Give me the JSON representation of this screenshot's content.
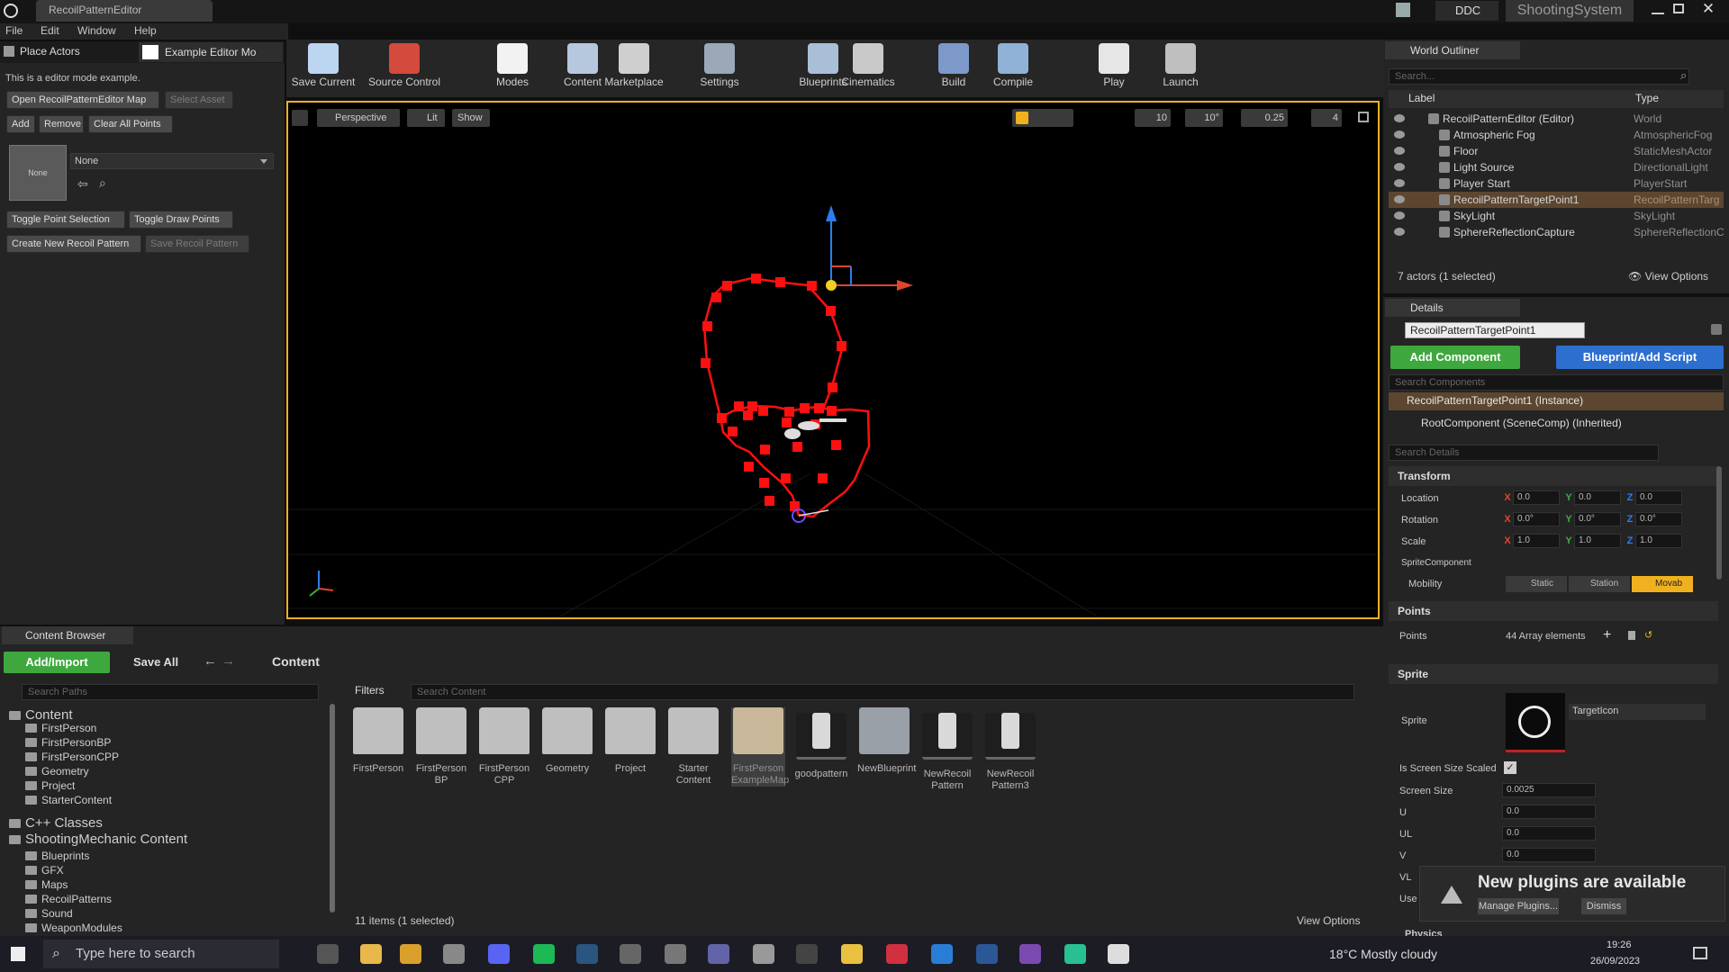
{
  "window": {
    "tab_title": "RecoilPatternEditor",
    "ddc_label": "DDC",
    "project_name": "ShootingSystem"
  },
  "menu": [
    "File",
    "Edit",
    "Window",
    "Help"
  ],
  "modes": {
    "place_actors": "Place Actors",
    "example_mode": "Example Editor Mo",
    "description": "This is a editor mode example.",
    "open_map": "Open RecoilPatternEditor Map",
    "select_asset": "Select Asset",
    "add": "Add",
    "remove": "Remove",
    "clear_all": "Clear All Points",
    "thumb_none": "None",
    "asset_dropdown": "None",
    "toggle_point_selection": "Toggle Point Selection",
    "toggle_draw_points": "Toggle Draw Points",
    "create_pattern": "Create New Recoil Pattern",
    "save_pattern": "Save Recoil Pattern"
  },
  "toolbar": [
    {
      "label": "Save Current",
      "color": "#bcd6f2"
    },
    {
      "label": "Source Control",
      "color": "#d44a3c"
    },
    {
      "label": "Modes",
      "color": "#f2f2f2"
    },
    {
      "label": "Content",
      "color": "#b6c8de"
    },
    {
      "label": "Marketplace",
      "color": "#cfcfcf"
    },
    {
      "label": "Settings",
      "color": "#9aa8b8"
    },
    {
      "label": "Blueprints",
      "color": "#a9bfd8"
    },
    {
      "label": "Cinematics",
      "color": "#c9c9c9"
    },
    {
      "label": "Build",
      "color": "#7d99c9"
    },
    {
      "label": "Compile",
      "color": "#8fb2d6"
    },
    {
      "label": "Play",
      "color": "#e6e6e6"
    },
    {
      "label": "Launch",
      "color": "#bfbfbf"
    }
  ],
  "viewport": {
    "perspective": "Perspective",
    "lit": "Lit",
    "show": "Show",
    "grid_snap": "10",
    "rot_snap": "10°",
    "scale_snap": "0.25",
    "cam_speed": "4"
  },
  "outliner": {
    "title": "World Outliner",
    "search_placeholder": "Search...",
    "col_label": "Label",
    "col_type": "Type",
    "rows": [
      {
        "label": "RecoilPatternEditor (Editor)",
        "type": "World"
      },
      {
        "label": "Atmospheric Fog",
        "type": "AtmosphericFog"
      },
      {
        "label": "Floor",
        "type": "StaticMeshActor"
      },
      {
        "label": "Light Source",
        "type": "DirectionalLight"
      },
      {
        "label": "Player Start",
        "type": "PlayerStart"
      },
      {
        "label": "RecoilPatternTargetPoint1",
        "type": "RecoilPatternTarg"
      },
      {
        "label": "SkyLight",
        "type": "SkyLight"
      },
      {
        "label": "SphereReflectionCapture",
        "type": "SphereReflectionC"
      }
    ],
    "status": "7 actors (1 selected)",
    "view_options": "View Options"
  },
  "details": {
    "title": "Details",
    "object_name": "RecoilPatternTargetPoint1",
    "add_component": "Add Component",
    "blueprint_script": "Blueprint/Add Script",
    "search_components": "Search Components",
    "instance": "RecoilPatternTargetPoint1 (Instance)",
    "root": "RootComponent (SceneComp) (Inherited)",
    "search_details": "Search Details",
    "transform": "Transform",
    "location": "Location",
    "rotation": "Rotation",
    "scale": "Scale",
    "loc_vals": [
      "0.0",
      "0.0",
      "0.0"
    ],
    "rot_vals": [
      "0.0°",
      "0.0°",
      "0.0°"
    ],
    "scale_vals": [
      "1.0",
      "1.0",
      "1.0"
    ],
    "sprite_component": "SpriteComponent",
    "mobility": "Mobility",
    "mob_static": "Static",
    "mob_stationary": "Station",
    "mob_movable": "Movab",
    "points_cat": "Points",
    "points_label": "Points",
    "points_value": "44 Array elements",
    "sprite_cat": "Sprite",
    "sprite_label": "Sprite",
    "sprite_asset": "TargetIcon",
    "screen_scaled": "Is Screen Size Scaled",
    "screen_size": "Screen Size",
    "screen_size_val": "0.0025",
    "u": "U",
    "u_val": "0.0",
    "ul": "UL",
    "ul_val": "0.0",
    "v": "V",
    "v_val": "0.0",
    "vl": "VL",
    "use": "Use",
    "physics": "Physics"
  },
  "notification": {
    "text": "New plugins are available",
    "manage": "Manage Plugins...",
    "dismiss": "Dismiss"
  },
  "content_browser": {
    "tab": "Content Browser",
    "add_import": "Add/Import",
    "save_all": "Save All",
    "path": "Content",
    "search_paths": "Search Paths",
    "filters": "Filters",
    "search_content": "Search Content",
    "status": "11 items (1 selected)",
    "view_options": "View Options",
    "tree": [
      {
        "label": "Content",
        "level": 0
      },
      {
        "label": "FirstPerson",
        "level": 1
      },
      {
        "label": "FirstPersonBP",
        "level": 1
      },
      {
        "label": "FirstPersonCPP",
        "level": 1
      },
      {
        "label": "Geometry",
        "level": 1
      },
      {
        "label": "Project",
        "level": 1
      },
      {
        "label": "StarterContent",
        "level": 1
      },
      {
        "label": "C++ Classes",
        "level": 0
      },
      {
        "label": "ShootingMechanic Content",
        "level": 0
      },
      {
        "label": "Blueprints",
        "level": 1
      },
      {
        "label": "GFX",
        "level": 1
      },
      {
        "label": "Maps",
        "level": 1
      },
      {
        "label": "RecoilPatterns",
        "level": 1
      },
      {
        "label": "Sound",
        "level": 1
      },
      {
        "label": "WeaponModules",
        "level": 1
      }
    ],
    "assets": [
      {
        "label": "FirstPerson",
        "kind": "folder"
      },
      {
        "label": "FirstPerson BP",
        "kind": "folder"
      },
      {
        "label": "FirstPerson CPP",
        "kind": "folder"
      },
      {
        "label": "Geometry",
        "kind": "folder"
      },
      {
        "label": "Project",
        "kind": "folder"
      },
      {
        "label": "Starter Content",
        "kind": "folder"
      },
      {
        "label": "FirstPerson ExampleMap",
        "kind": "map"
      },
      {
        "label": "goodpattern",
        "kind": "asset"
      },
      {
        "label": "NewBlueprint",
        "kind": "blueprint"
      },
      {
        "label": "NewRecoil Pattern",
        "kind": "asset"
      },
      {
        "label": "NewRecoil Pattern3",
        "kind": "asset"
      }
    ]
  },
  "taskbar": {
    "search": "Type here to search",
    "weather": "18°C  Mostly cloudy",
    "time": "19:26",
    "date": "26/09/2023"
  },
  "colors": {
    "accent_orange": "#f0b11f",
    "green": "#3ea83e",
    "blue": "#2d6fcf",
    "points_red": "#ff1010"
  }
}
